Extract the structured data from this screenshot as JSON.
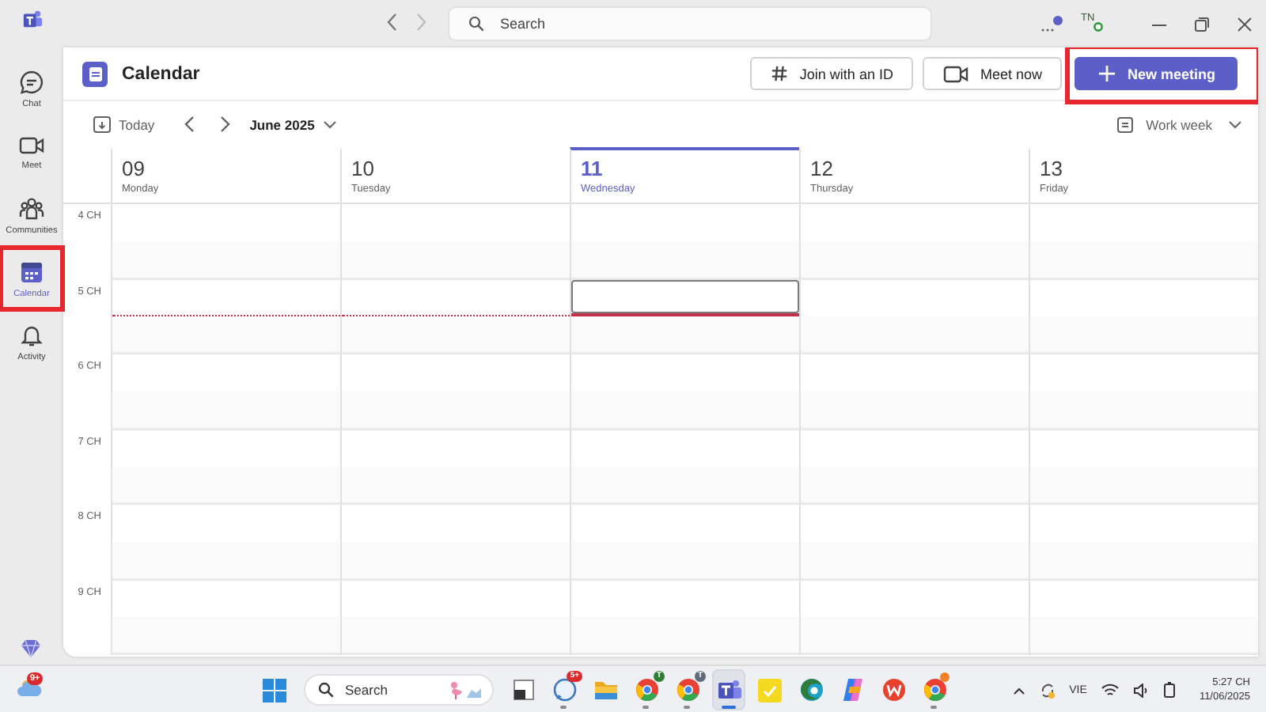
{
  "title_bar": {
    "search_placeholder": "Search",
    "avatar": "TN"
  },
  "sidebar": {
    "items": [
      {
        "label": "Chat",
        "selected": false,
        "highlighted": false
      },
      {
        "label": "Meet",
        "selected": false,
        "highlighted": false
      },
      {
        "label": "Communities",
        "selected": false,
        "highlighted": false
      },
      {
        "label": "Calendar",
        "selected": true,
        "highlighted": true
      },
      {
        "label": "Activity",
        "selected": false,
        "highlighted": false
      }
    ]
  },
  "header": {
    "title": "Calendar",
    "buttons": [
      {
        "label": "Join with an ID",
        "kind": "secondary",
        "highlighted": false
      },
      {
        "label": "Meet now",
        "kind": "secondary",
        "highlighted": false
      },
      {
        "label": "New meeting",
        "kind": "primary",
        "highlighted": true
      }
    ]
  },
  "toolbar": {
    "today": "Today",
    "period": "June 2025",
    "view": "Work week"
  },
  "days": [
    {
      "date": "09",
      "weekday": "Monday",
      "selected": false
    },
    {
      "date": "10",
      "weekday": "Tuesday",
      "selected": false
    },
    {
      "date": "11",
      "weekday": "Wednesday",
      "selected": true
    },
    {
      "date": "12",
      "weekday": "Thursday",
      "selected": false
    },
    {
      "date": "13",
      "weekday": "Friday",
      "selected": false
    }
  ],
  "hours": [
    {
      "label": "4 CH",
      "selected": false
    },
    {
      "label": "5 CH",
      "selected": true,
      "now": true
    },
    {
      "label": "6 CH",
      "selected": false
    },
    {
      "label": "7 CH",
      "selected": false
    },
    {
      "label": "8 CH",
      "selected": false
    },
    {
      "label": "9 CH",
      "selected": false
    }
  ],
  "taskbar": {
    "weather_badge": "9+",
    "search_placeholder": "Search",
    "apps": [
      {
        "kind": "start",
        "running": false,
        "selected": false
      },
      {
        "kind": "taskview",
        "running": false,
        "selected": false
      },
      {
        "kind": "bubble",
        "badge": "5+",
        "running": true,
        "selected": false
      },
      {
        "kind": "folder",
        "running": false,
        "selected": false
      },
      {
        "kind": "browser",
        "badge": "T",
        "color": "#2e7d32",
        "running": true,
        "selected": false
      },
      {
        "kind": "browser",
        "badge": "T",
        "color": "#5f6b7a",
        "running": true,
        "selected": false
      },
      {
        "kind": "teams",
        "running": true,
        "selected": true
      },
      {
        "kind": "note",
        "running": false,
        "selected": false
      },
      {
        "kind": "edge",
        "running": false,
        "selected": false
      },
      {
        "kind": "copilot",
        "running": false,
        "selected": false
      },
      {
        "kind": "office",
        "running": false,
        "selected": false
      },
      {
        "kind": "browser",
        "color": "#f0802a",
        "running": true,
        "selected": false
      }
    ],
    "tray": {
      "language": "VIE",
      "time": "5:27 CH",
      "date": "11/06/2025"
    }
  }
}
